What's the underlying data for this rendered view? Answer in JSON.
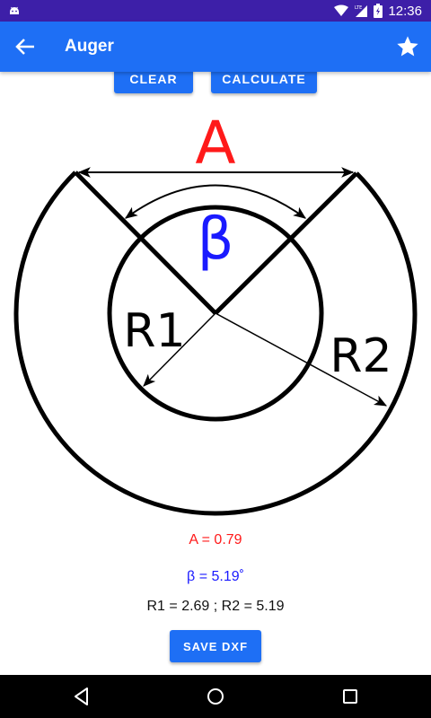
{
  "status_bar": {
    "time": "12:36",
    "network_label": "LTE",
    "icons": [
      "android-icon",
      "wifi-icon",
      "cellular-signal-icon",
      "battery-icon"
    ]
  },
  "app_bar": {
    "title": "Auger",
    "icons": [
      "back-arrow-icon",
      "star-icon"
    ]
  },
  "actions": {
    "clear_label": "CLEAR",
    "calculate_label": "CALCULATE",
    "save_dxf_label": "SAVE DXF"
  },
  "diagram": {
    "label_a": "A",
    "label_beta": "β",
    "label_r1": "R1",
    "label_r2": "R2",
    "colors": {
      "a": "#ff1a1a",
      "beta": "#1a1aff",
      "lines": "#000000"
    }
  },
  "results": {
    "a_text": "A = 0.79",
    "beta_text": "β = 5.19˚",
    "r_text": "R1 = 2.69 ; R2 = 5.19"
  },
  "nav_bar": {
    "icons": [
      "nav-back-icon",
      "nav-home-icon",
      "nav-recents-icon"
    ]
  }
}
